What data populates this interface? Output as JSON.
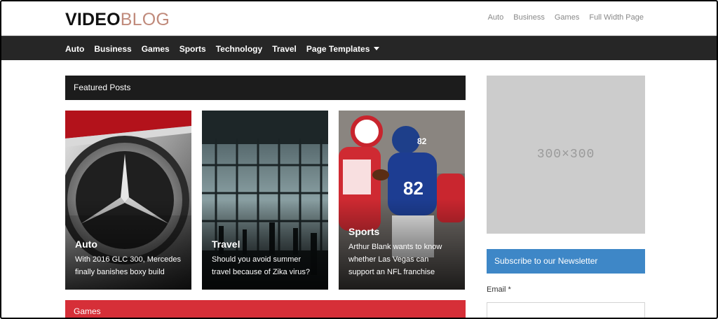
{
  "header": {
    "logo_bold": "VIDEO",
    "logo_light": "BLOG",
    "top_links": [
      "Auto",
      "Business",
      "Games",
      "Full Width Page"
    ]
  },
  "nav": {
    "items": [
      "Auto",
      "Business",
      "Games",
      "Sports",
      "Technology",
      "Travel",
      "Page Templates"
    ]
  },
  "featured": {
    "heading": "Featured Posts",
    "cards": [
      {
        "category": "Auto",
        "title": "With 2016 GLC 300, Mercedes finally banishes boxy build"
      },
      {
        "category": "Travel",
        "title": "Should you avoid summer travel because of Zika virus?"
      },
      {
        "category": "Sports",
        "title": "Arthur Blank wants to know whether Las Vegas can support an NFL franchise"
      }
    ]
  },
  "games": {
    "heading": "Games"
  },
  "sidebar": {
    "ad_label": "300×300",
    "newsletter_heading": "Subscribe to our Newsletter",
    "email_label": "Email *",
    "email_value": ""
  },
  "colors": {
    "nav_bg": "#262626",
    "logo_accent": "#c08a7b",
    "games_red": "#d62f38",
    "newsletter_blue": "#3e87c7"
  }
}
